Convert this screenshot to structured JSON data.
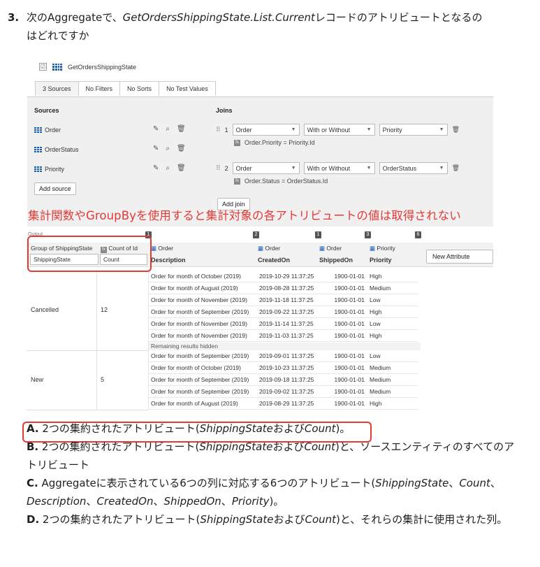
{
  "question": {
    "number": "3.",
    "line1_prefix": "次のAggregateで、",
    "line1_italic": "GetOrdersShippingState.List.Current",
    "line1_suffix": "レコードのアトリビュートとなるの",
    "line2": "はどれですか"
  },
  "aggregate": {
    "name": "GetOrdersShippingState",
    "tabs": [
      "3 Sources",
      "No Filters",
      "No Sorts",
      "No Test Values"
    ],
    "sources_title": "Sources",
    "joins_title": "Joins",
    "sources": [
      "Order",
      "OrderStatus",
      "Priority"
    ],
    "add_source": "Add source",
    "add_join": "Add join",
    "joins": [
      {
        "num": "1",
        "left": "Order",
        "type": "With or Without",
        "right": "Priority",
        "condition": "Order.Priority = Priority.Id"
      },
      {
        "num": "2",
        "left": "Order",
        "type": "With or Without",
        "right": "OrderStatus",
        "condition": "Order.Status = OrderStatus.Id"
      }
    ]
  },
  "note": "集計関数やGroupByを使用すると集計対象の各アトリビュートの値は取得されない",
  "output": {
    "label": "Output",
    "badges": [
      "1",
      "2",
      "1",
      "3",
      "6"
    ],
    "columns": [
      {
        "entity": "Group of ShippingState",
        "input": "ShippingState"
      },
      {
        "entity": "Count of Id",
        "input": "Count"
      },
      {
        "entity": "Order",
        "attr": "Description"
      },
      {
        "entity": "Order",
        "attr": "CreatedOn"
      },
      {
        "entity": "Order",
        "attr": "ShippedOn"
      },
      {
        "entity": "Priority",
        "attr": "Priority"
      }
    ],
    "new_attribute": "New Attribute",
    "remaining_hidden": "Remaining results hidden",
    "groups": [
      {
        "state": "Cancelled",
        "count": "12",
        "rows": [
          [
            "Order for month of October (2019)",
            "2019-10-29 11:37:25",
            "1900-01-01",
            "High"
          ],
          [
            "Order for month of August (2019)",
            "2019-08-28 11:37:25",
            "1900-01-01",
            "Medium"
          ],
          [
            "Order for month of November (2019)",
            "2019-11-18 11:37:25",
            "1900-01-01",
            "Low"
          ],
          [
            "Order for month of September (2019)",
            "2019-09-22 11:37:25",
            "1900-01-01",
            "High"
          ],
          [
            "Order for month of November (2019)",
            "2019-11-14 11:37:25",
            "1900-01-01",
            "Low"
          ],
          [
            "Order for month of November (2019)",
            "2019-11-03 11:37:25",
            "1900-01-01",
            "High"
          ]
        ]
      },
      {
        "state": "New",
        "count": "5",
        "rows": [
          [
            "Order for month of September (2019)",
            "2019-09-01 11:37:25",
            "1900-01-01",
            "Low"
          ],
          [
            "Order for month of October (2019)",
            "2019-10-23 11:37:25",
            "1900-01-01",
            "Medium"
          ],
          [
            "Order for month of September (2019)",
            "2019-09-18 11:37:25",
            "1900-01-01",
            "Medium"
          ],
          [
            "Order for month of September (2019)",
            "2019-09-02 11:37:25",
            "1900-01-01",
            "Medium"
          ],
          [
            "Order for month of August (2019)",
            "2019-08-29 11:37:25",
            "1900-01-01",
            "High"
          ]
        ]
      }
    ]
  },
  "answers": {
    "a_label": "A.",
    "a_text": " 2つの集約されたアトリビュート(",
    "a_i1": "ShippingState",
    "a_mid": "および",
    "a_i2": "Count",
    "a_end": ")。",
    "b_label": "B.",
    "b_text1": " 2つの集約されたアトリビュート(",
    "b_i1": "ShippingState",
    "b_mid": "および",
    "b_i2": "Count",
    "b_text2": ")と、ソースエンティティのすべてのアトリビュート",
    "c_label": "C.",
    "c_text1": " Aggregateに表示されている6つの列に対応する6つのアトリビュート(",
    "c_i1": "ShippingState",
    "c_sep1": "、",
    "c_i2": "Count",
    "c_sep2": "、",
    "c_i3": "Description",
    "c_sep3": "、",
    "c_i4": "CreatedOn",
    "c_sep4": "、",
    "c_i5": "ShippedOn",
    "c_sep5": "、",
    "c_i6": "Priority",
    "c_end": ")。",
    "d_label": "D.",
    "d_text1": " 2つの集約されたアトリビュート(",
    "d_i1": "ShippingState",
    "d_mid": "および",
    "d_i2": "Count",
    "d_text2": ")と、それらの集計に使用された列。"
  }
}
